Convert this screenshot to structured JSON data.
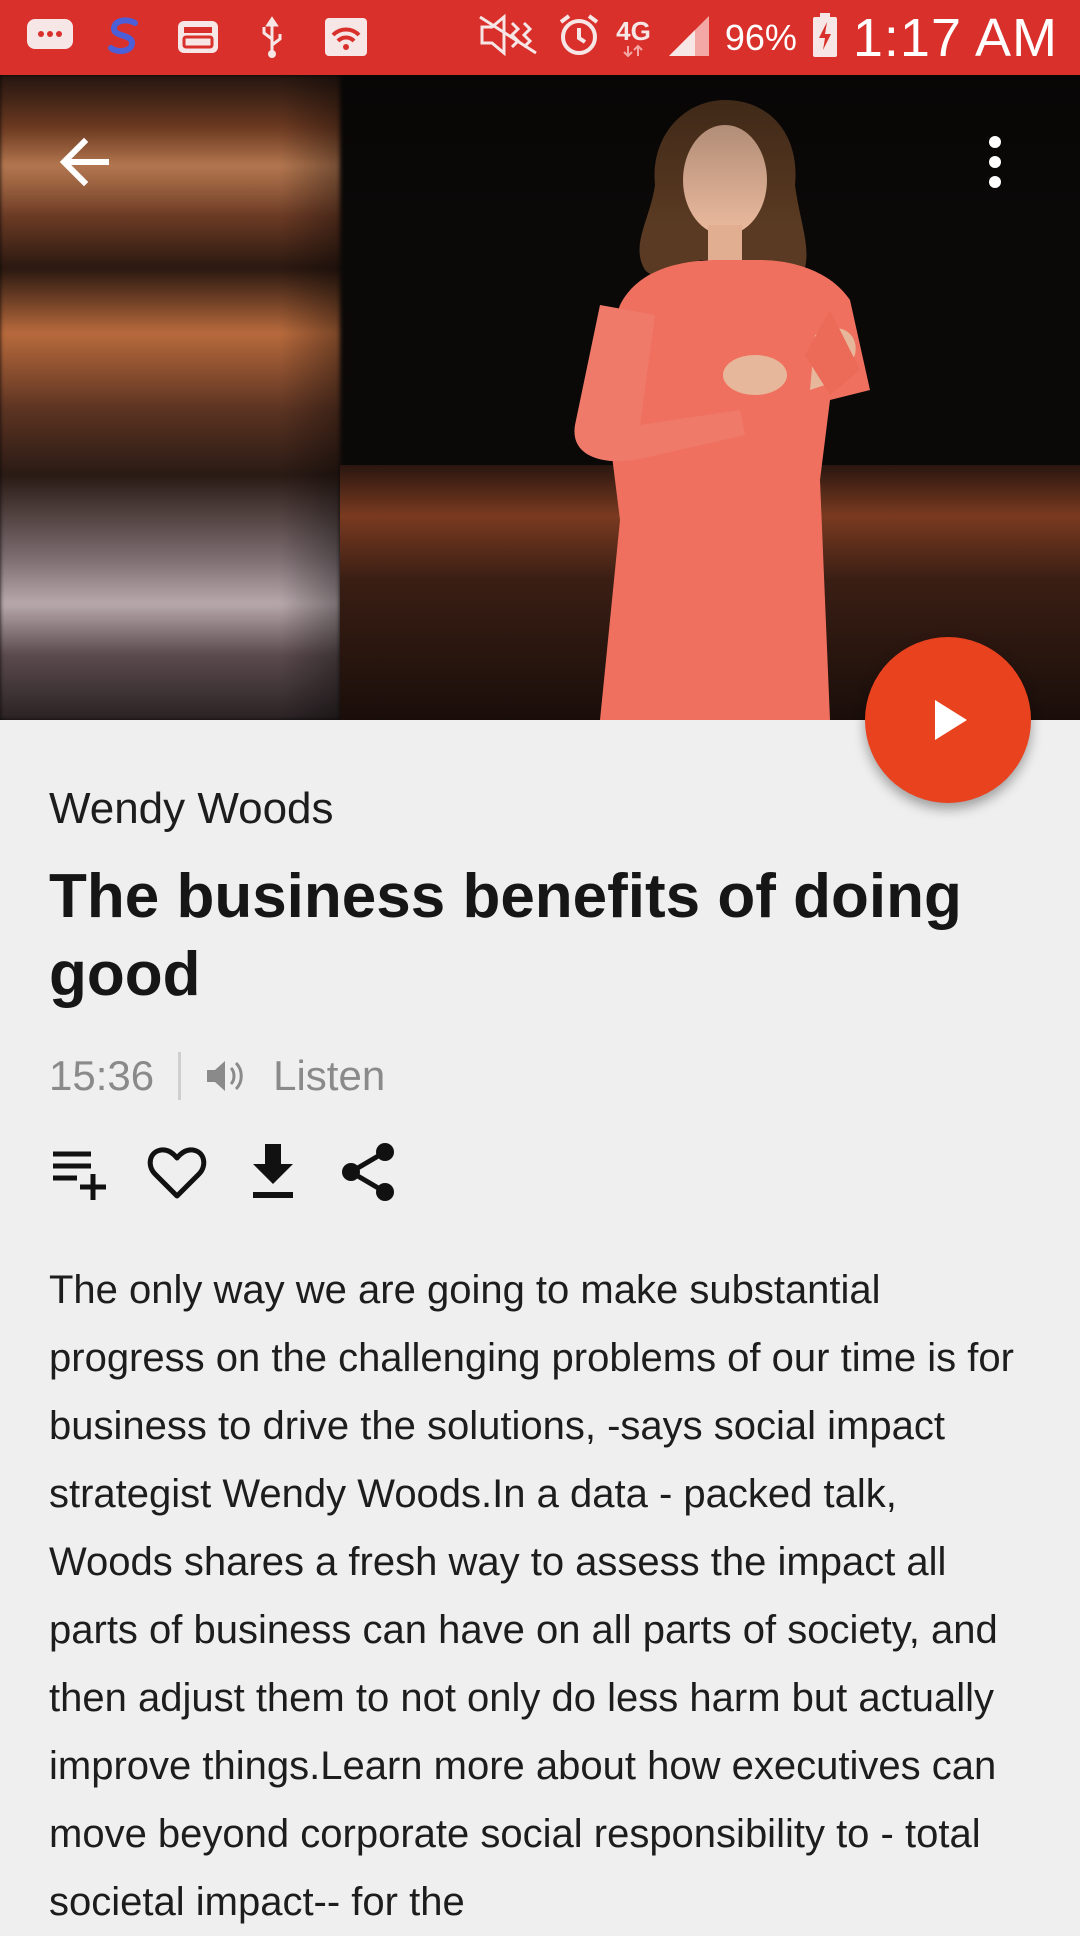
{
  "status_bar": {
    "battery_percent": "96%",
    "network": "4G",
    "time": "1:17 AM",
    "icons": [
      "messaging-icon",
      "swiftkey-icon",
      "inbox-icon",
      "usb-icon",
      "wifi-box-icon",
      "mute-icon",
      "alarm-icon",
      "network-4g-icon",
      "signal-icon",
      "battery-charging-icon"
    ]
  },
  "header": {
    "back_icon": "arrow-back-icon",
    "more_icon": "more-vert-icon"
  },
  "talk": {
    "speaker": "Wendy Woods",
    "title": "The business benefits of doing good",
    "duration": "15:36",
    "listen_label": "Listen",
    "description": "The only way we are going to make substantial progress on the challenging problems of our time is for business to drive the solutions, -says social impact strategist Wendy Woods.In a data - packed talk, Woods shares a fresh way to assess the impact all parts of business can have on all parts of society, and then adjust them to not only do less harm but actually improve things.Learn more about how executives can move beyond corporate social responsibility to - total societal impact-- for the"
  },
  "actions": [
    "add-to-playlist-icon",
    "favorite-icon",
    "download-icon",
    "share-icon"
  ],
  "colors": {
    "status_bar": "#d9302b",
    "fab": "#e8421f",
    "background": "#efefef"
  }
}
